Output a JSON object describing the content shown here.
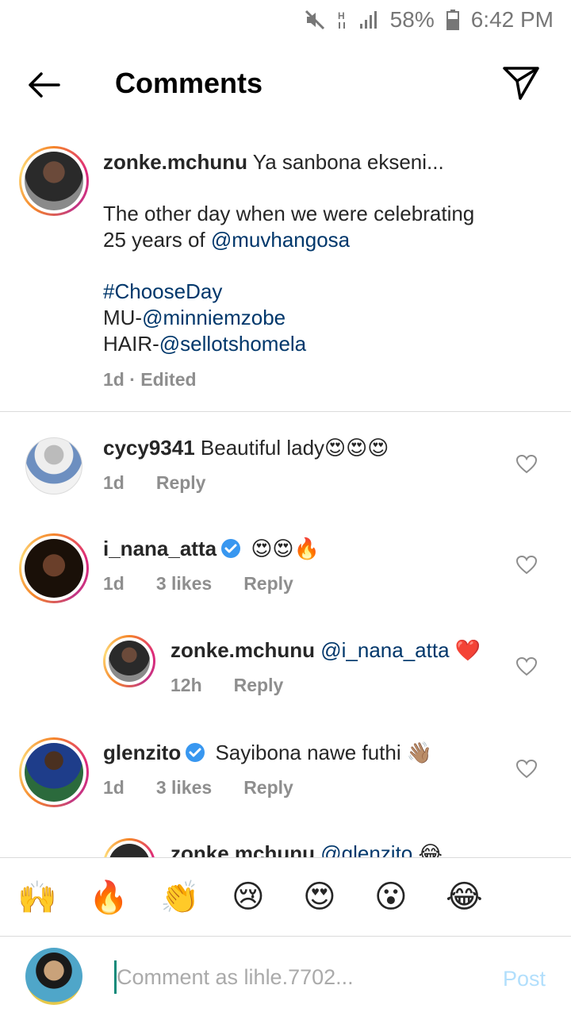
{
  "status_bar": {
    "battery": "58%",
    "time": "6:42 PM",
    "network": "H"
  },
  "header": {
    "title": "Comments"
  },
  "caption": {
    "username": "zonke.mchunu",
    "line1": "Ya sanbona ekseni...",
    "line2": "The other day when we were celebrating",
    "line3_prefix": "25 years of ",
    "line3_mention": "@muvhangosa",
    "hashtag": "#ChooseDay",
    "mu_prefix": "MU-",
    "mu_mention": "@minniemzobe",
    "hair_prefix": "HAIR-",
    "hair_mention": "@sellotshomela",
    "meta": "1d · Edited"
  },
  "comments": [
    {
      "username": "cycy9341",
      "text": "Beautiful lady",
      "emoji": "😍😍😍",
      "time": "1d",
      "likes": "",
      "reply": "Reply"
    },
    {
      "username": "i_nana_atta",
      "text": "",
      "emoji": "😍😍🔥",
      "time": "1d",
      "likes": "3 likes",
      "reply": "Reply"
    },
    {
      "username": "zonke.mchunu",
      "mention": "@i_nana_atta",
      "emoji": "❤️",
      "time": "12h",
      "likes": "",
      "reply": "Reply"
    },
    {
      "username": "glenzito",
      "text": "Sayibona nawe futhi",
      "emoji": "👋🏽",
      "time": "1d",
      "likes": "3 likes",
      "reply": "Reply"
    },
    {
      "username": "zonke.mchunu",
      "mention": "@glenzito",
      "emoji": "😂"
    }
  ],
  "reactions": [
    "🙌",
    "🔥",
    "👏",
    "😢",
    "😍",
    "😮",
    "😂"
  ],
  "composer": {
    "placeholder": "Comment as lihle.7702...",
    "post_label": "Post"
  },
  "colors": {
    "link": "#00376b",
    "meta": "#8e8e8e",
    "post": "#b2dffc",
    "verified": "#3897f0"
  }
}
